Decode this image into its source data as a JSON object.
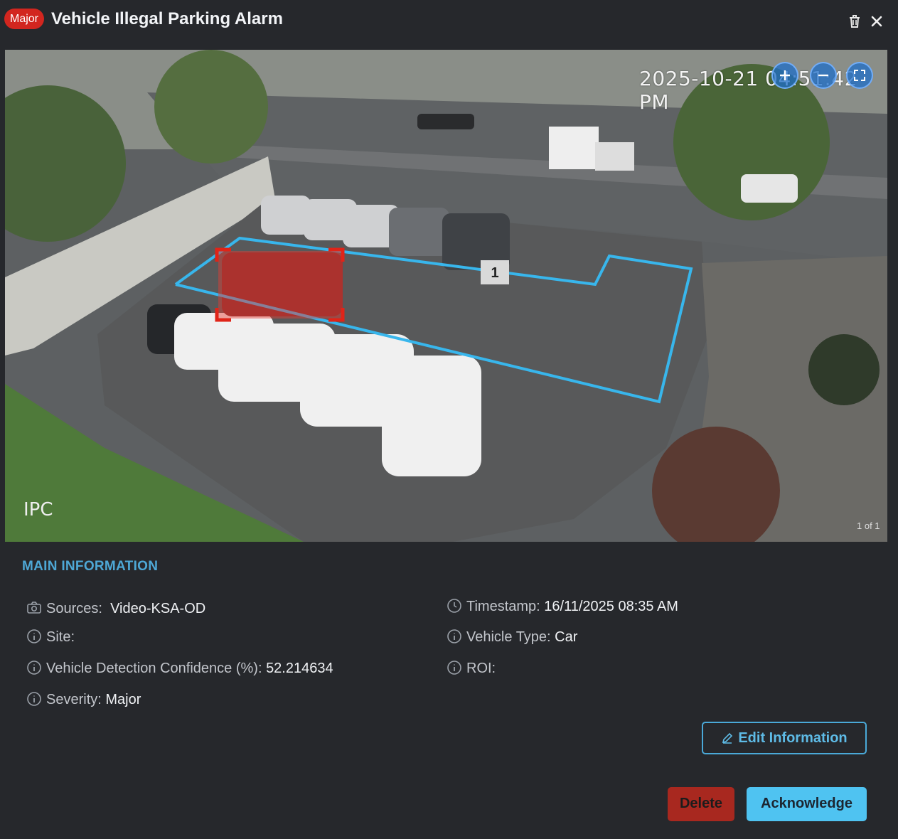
{
  "header": {
    "severity_badge": "Major",
    "title": "Vehicle Illegal Parking Alarm",
    "icons": [
      "trash-icon",
      "close-icon"
    ]
  },
  "video": {
    "timestamp_overlay": "2025-10-21 04:51:42 PM",
    "camera_label": "IPC",
    "pager": "1 of 1",
    "roi_label": "1",
    "controls": [
      "zoom-in-icon",
      "zoom-out-icon",
      "fullscreen-icon"
    ],
    "roi_color": "#38b6ec",
    "detection_color": "#e02418"
  },
  "main_info": {
    "section_title": "MAIN INFORMATION",
    "sources_label": "Sources:",
    "sources_value": "Video-KSA-OD",
    "site_label": "Site:",
    "site_value": "",
    "confidence_label": "Vehicle Detection Confidence (%):",
    "confidence_value": "52.214634",
    "severity_label": "Severity:",
    "severity_value": "Major",
    "timestamp_label": "Timestamp:",
    "timestamp_value": "16/11/2025 08:35 AM",
    "vehicle_type_label": "Vehicle Type:",
    "vehicle_type_value": "Car",
    "roi_label": "ROI:",
    "roi_value": ""
  },
  "actions": {
    "edit_label": "Edit Information",
    "delete_label": "Delete",
    "acknowledge_label": "Acknowledge"
  },
  "colors": {
    "background": "#26282c",
    "accent": "#4fc3f1",
    "danger": "#a8281f",
    "badge": "#d2261f"
  }
}
